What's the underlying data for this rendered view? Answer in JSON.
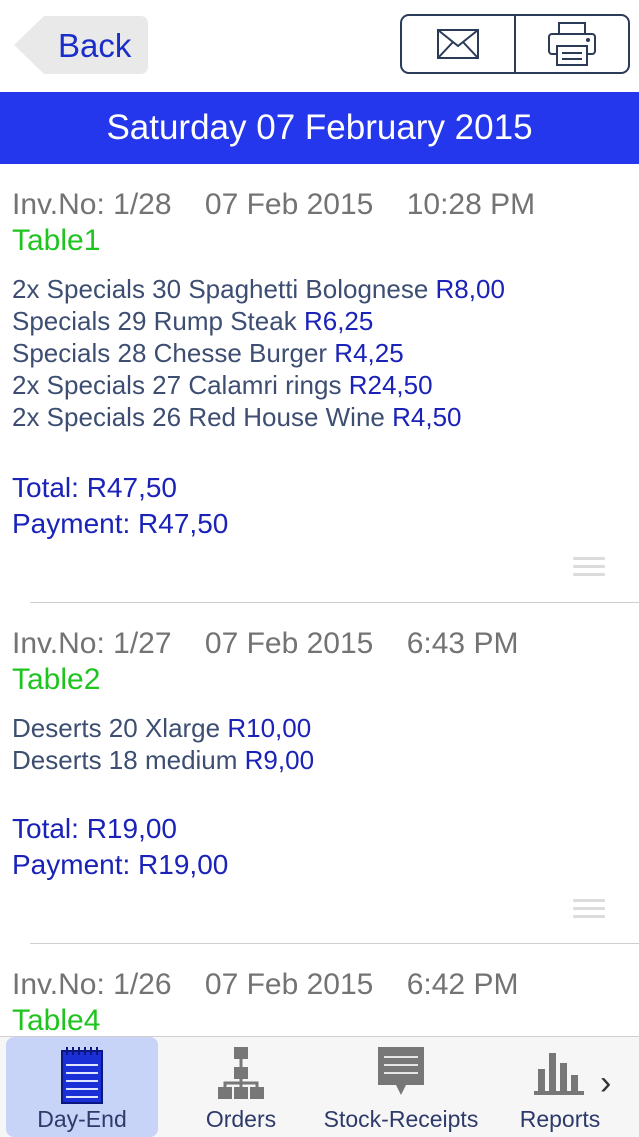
{
  "nav": {
    "back_label": "Back"
  },
  "header": {
    "date": "Saturday 07 February 2015"
  },
  "invoices": [
    {
      "inv_no": "Inv.No: 1/28",
      "date": "07 Feb 2015",
      "time": "10:28 PM",
      "table": "Table1",
      "items": [
        {
          "desc": "2x Specials 30 Spaghetti Bolognese",
          "price": "R8,00"
        },
        {
          "desc": "Specials 29 Rump Steak",
          "price": "R6,25"
        },
        {
          "desc": "Specials 28 Chesse Burger",
          "price": "R4,25"
        },
        {
          "desc": "2x Specials 27 Calamri rings",
          "price": "R24,50"
        },
        {
          "desc": "2x Specials 26 Red House Wine",
          "price": "R4,50"
        }
      ],
      "total": "Total: R47,50",
      "payment": "Payment: R47,50"
    },
    {
      "inv_no": "Inv.No: 1/27",
      "date": "07 Feb 2015",
      "time": "6:43 PM",
      "table": "Table2",
      "items": [
        {
          "desc": "Deserts 20 Xlarge ",
          "price": "R10,00"
        },
        {
          "desc": "Deserts 18 medium ",
          "price": "R9,00"
        }
      ],
      "total": "Total: R19,00",
      "payment": "Payment: R19,00"
    },
    {
      "inv_no": "Inv.No: 1/26",
      "date": "07 Feb 2015",
      "time": "6:42 PM",
      "table": "Table4",
      "items": [],
      "total": "",
      "payment": ""
    }
  ],
  "tabs": [
    {
      "label": "Day-End",
      "icon": "notepad-icon",
      "active": true
    },
    {
      "label": "Orders",
      "icon": "org-chart-icon",
      "active": false
    },
    {
      "label": "Stock-Receipts",
      "icon": "receipt-icon",
      "active": false
    },
    {
      "label": "Reports",
      "icon": "bar-chart-icon",
      "active": false
    }
  ],
  "colors": {
    "accent": "#2437ec",
    "table": "#1fc41f",
    "price": "#1a22b8",
    "active_tab": "#c7d3f7"
  }
}
